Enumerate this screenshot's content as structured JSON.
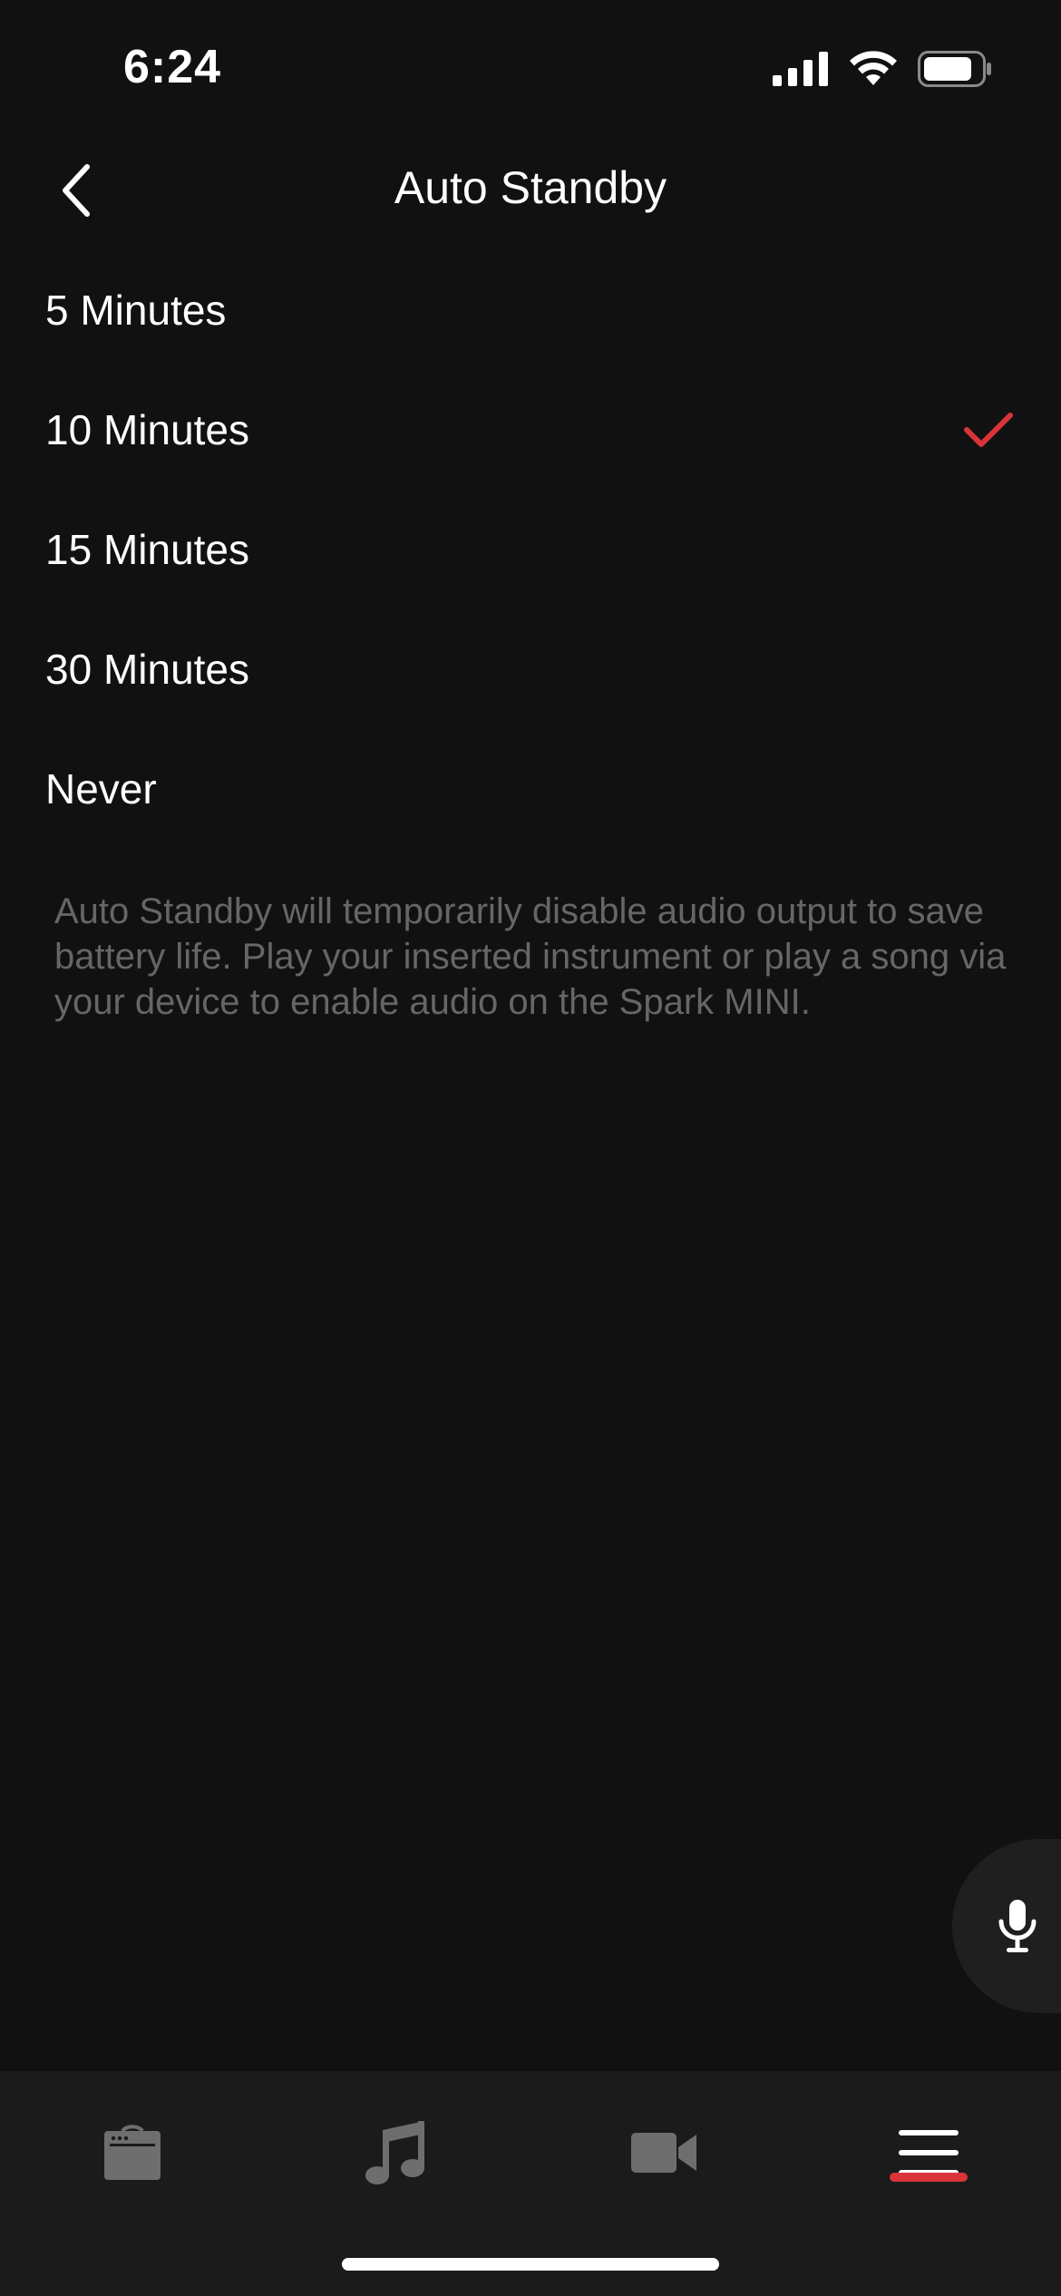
{
  "status_bar": {
    "time": "6:24",
    "icons": [
      "cellular-signal-icon",
      "wifi-icon",
      "battery-icon"
    ]
  },
  "header": {
    "title": "Auto Standby",
    "back_icon": "chevron-left-icon"
  },
  "options": [
    {
      "label": "5 Minutes",
      "selected": false
    },
    {
      "label": "10 Minutes",
      "selected": true
    },
    {
      "label": "15 Minutes",
      "selected": false
    },
    {
      "label": "30 Minutes",
      "selected": false
    },
    {
      "label": "Never",
      "selected": false
    }
  ],
  "description": "Auto Standby will temporarily disable audio output to save battery life. Play your inserted instrument or play a song via your device to enable audio on the Spark MINI.",
  "mic_button": {
    "icon": "microphone-icon"
  },
  "tab_bar": {
    "tabs": [
      {
        "icon": "amp-icon",
        "active": false
      },
      {
        "icon": "music-note-icon",
        "active": false
      },
      {
        "icon": "video-camera-icon",
        "active": false
      },
      {
        "icon": "menu-icon",
        "active": true
      }
    ]
  },
  "colors": {
    "background": "#111111",
    "accent": "#d8343a",
    "text_primary": "#ffffff",
    "text_secondary": "#666666",
    "tab_bar_bg": "#1b1b1b",
    "inactive_icon": "#6e6e6e"
  }
}
